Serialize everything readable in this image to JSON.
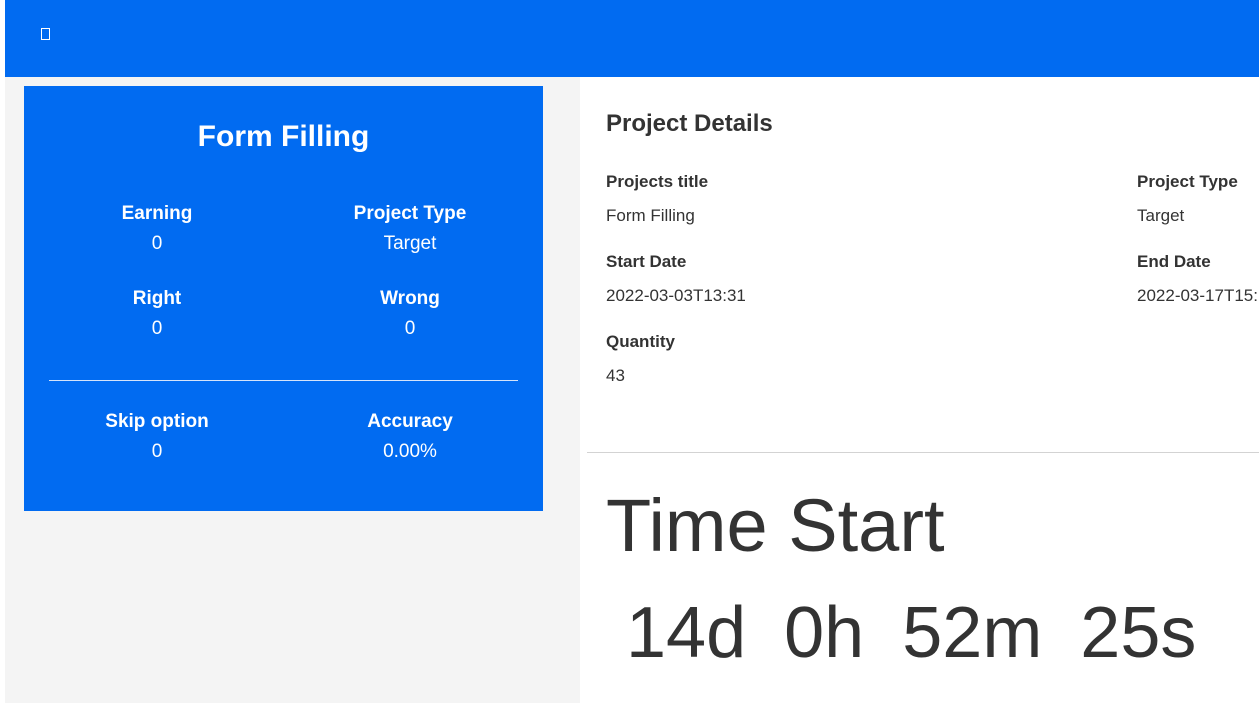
{
  "header": {
    "menu_icon": "menu-toggle-icon"
  },
  "stats": {
    "title": "Form Filling",
    "earning_label": "Earning",
    "earning_value": "0",
    "project_type_label": "Project Type",
    "project_type_value": "Target",
    "right_label": "Right",
    "right_value": "0",
    "wrong_label": "Wrong",
    "wrong_value": "0",
    "skip_label": "Skip option",
    "skip_value": "0",
    "accuracy_label": "Accuracy",
    "accuracy_value": "0.00%"
  },
  "details": {
    "title": "Project Details",
    "projects_title_label": "Projects title",
    "projects_title_value": "Form Filling",
    "project_type_label": "Project Type",
    "project_type_value": "Target",
    "start_date_label": "Start Date",
    "start_date_value": "2022-03-03T13:31",
    "end_date_label": "End Date",
    "end_date_value": "2022-03-17T15:",
    "quantity_label": "Quantity",
    "quantity_value": "43"
  },
  "timer": {
    "title": "Time Start",
    "days": "14d",
    "hours": "0h",
    "minutes": "52m",
    "seconds": "25s"
  },
  "colors": {
    "brand_blue": "#016bf1",
    "sidebar_bg": "#f4f4f4",
    "text": "#333333"
  }
}
